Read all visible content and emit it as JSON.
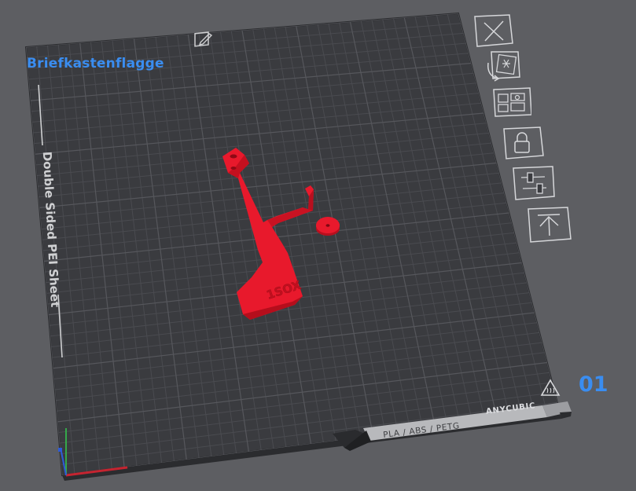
{
  "plate": {
    "name": "Briefkastenflagge",
    "index": "01",
    "sheet_type": "Double Sided PEI Sheet",
    "materials": "PLA / ABS / PETG",
    "brand": "ANYCUBIC"
  },
  "toolbar": [
    {
      "name": "delete-plate-button",
      "icon": "close-icon"
    },
    {
      "name": "auto-orient-button",
      "icon": "auto-orient-icon"
    },
    {
      "name": "arrange-button",
      "icon": "arrange-icon"
    },
    {
      "name": "lock-plate-button",
      "icon": "lock-icon"
    },
    {
      "name": "plate-settings-button",
      "icon": "sliders-icon"
    },
    {
      "name": "move-to-top-button",
      "icon": "move-top-icon"
    }
  ],
  "model": {
    "color": "#e8192c",
    "label_text": "1SOX"
  },
  "colors": {
    "background": "#5d5e62",
    "bed": "#3a3b3f",
    "grid": "#4b4c51",
    "accent": "#3a8df0",
    "toolbar_line": "#d6d7da"
  }
}
